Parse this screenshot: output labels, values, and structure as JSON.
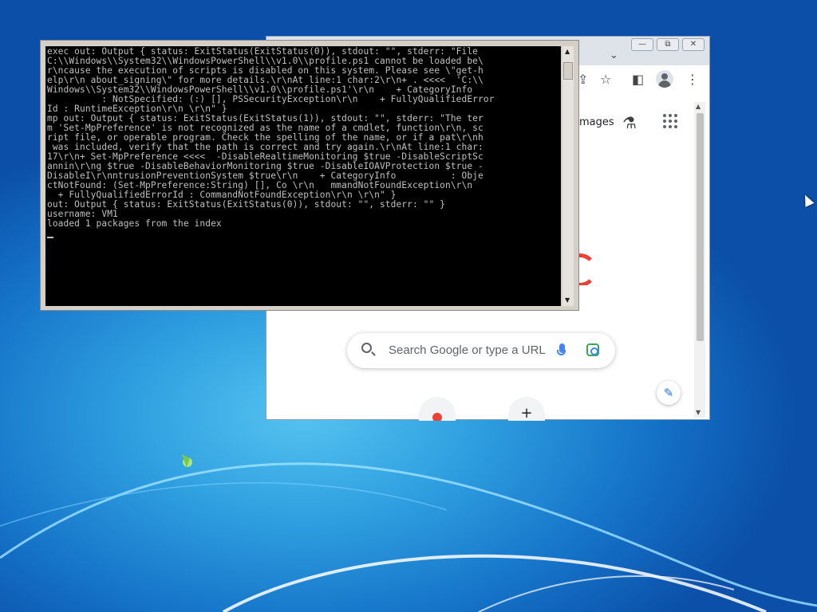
{
  "console": {
    "lines": [
      "exec out: Output { status: ExitStatus(ExitStatus(0)), stdout: \"\", stderr: \"File",
      "C:\\\\Windows\\\\System32\\\\WindowsPowerShell\\\\v1.0\\\\profile.ps1 cannot be loaded be\\",
      "r\\ncause the execution of scripts is disabled on this system. Please see \\\"get-h",
      "elp\\r\\n about_signing\\\" for more details.\\r\\nAt line:1 char:2\\r\\n+ . <<<<  'C:\\\\",
      "Windows\\\\System32\\\\WindowsPowerShell\\\\v1.0\\\\profile.ps1'\\r\\n    + CategoryInfo",
      "          : NotSpecified: (:) [], PSSecurityException\\r\\n    + FullyQualifiedError",
      "Id : RuntimeException\\r\\n \\r\\n\" }",
      "mp out: Output { status: ExitStatus(ExitStatus(1)), stdout: \"\", stderr: \"The ter",
      "m 'Set-MpPreference' is not recognized as the name of a cmdlet, function\\r\\n, sc",
      "ript file, or operable program. Check the spelling of the name, or if a pat\\r\\nh",
      " was included, verify that the path is correct and try again.\\r\\nAt line:1 char:",
      "17\\r\\n+ Set-MpPreference <<<<  -DisableRealtimeMonitoring $true -DisableScriptSc",
      "annin\\r\\ng $true -DisableBehaviorMonitoring $true -DisableIOAVProtection $true -",
      "DisableI\\r\\nntrusionPreventionSystem $true\\r\\n    + CategoryInfo          : Obje",
      "ctNotFound: (Set-MpPreference:String) [], Co \\r\\n   mmandNotFoundException\\r\\n",
      "  + FullyQualifiedErrorId : CommandNotFoundException\\r\\n \\r\\n\" }",
      "out: Output { status: ExitStatus(ExitStatus(0)), stdout: \"\", stderr: \"\" }",
      "username: VM1",
      "loaded 1 packages from the index"
    ]
  },
  "chrome": {
    "window_buttons": {
      "minimize": "—",
      "restore": "⧉",
      "close": "✕"
    },
    "tab_dropdown": "⌄",
    "toolbar": {
      "share": "⇪",
      "bookmark": "☆",
      "sidepanel": "◧",
      "menu": "⋮"
    },
    "ntp": {
      "images_link": "mages",
      "lab_icon": "⚗",
      "search_placeholder": "Search Google or type a URL",
      "edit_glyph": "✎",
      "add_shortcut": "+"
    }
  },
  "colors": {
    "console_bg": "#000000",
    "console_text": "#c0c0c0",
    "desktop_blue": "#1573c8"
  }
}
